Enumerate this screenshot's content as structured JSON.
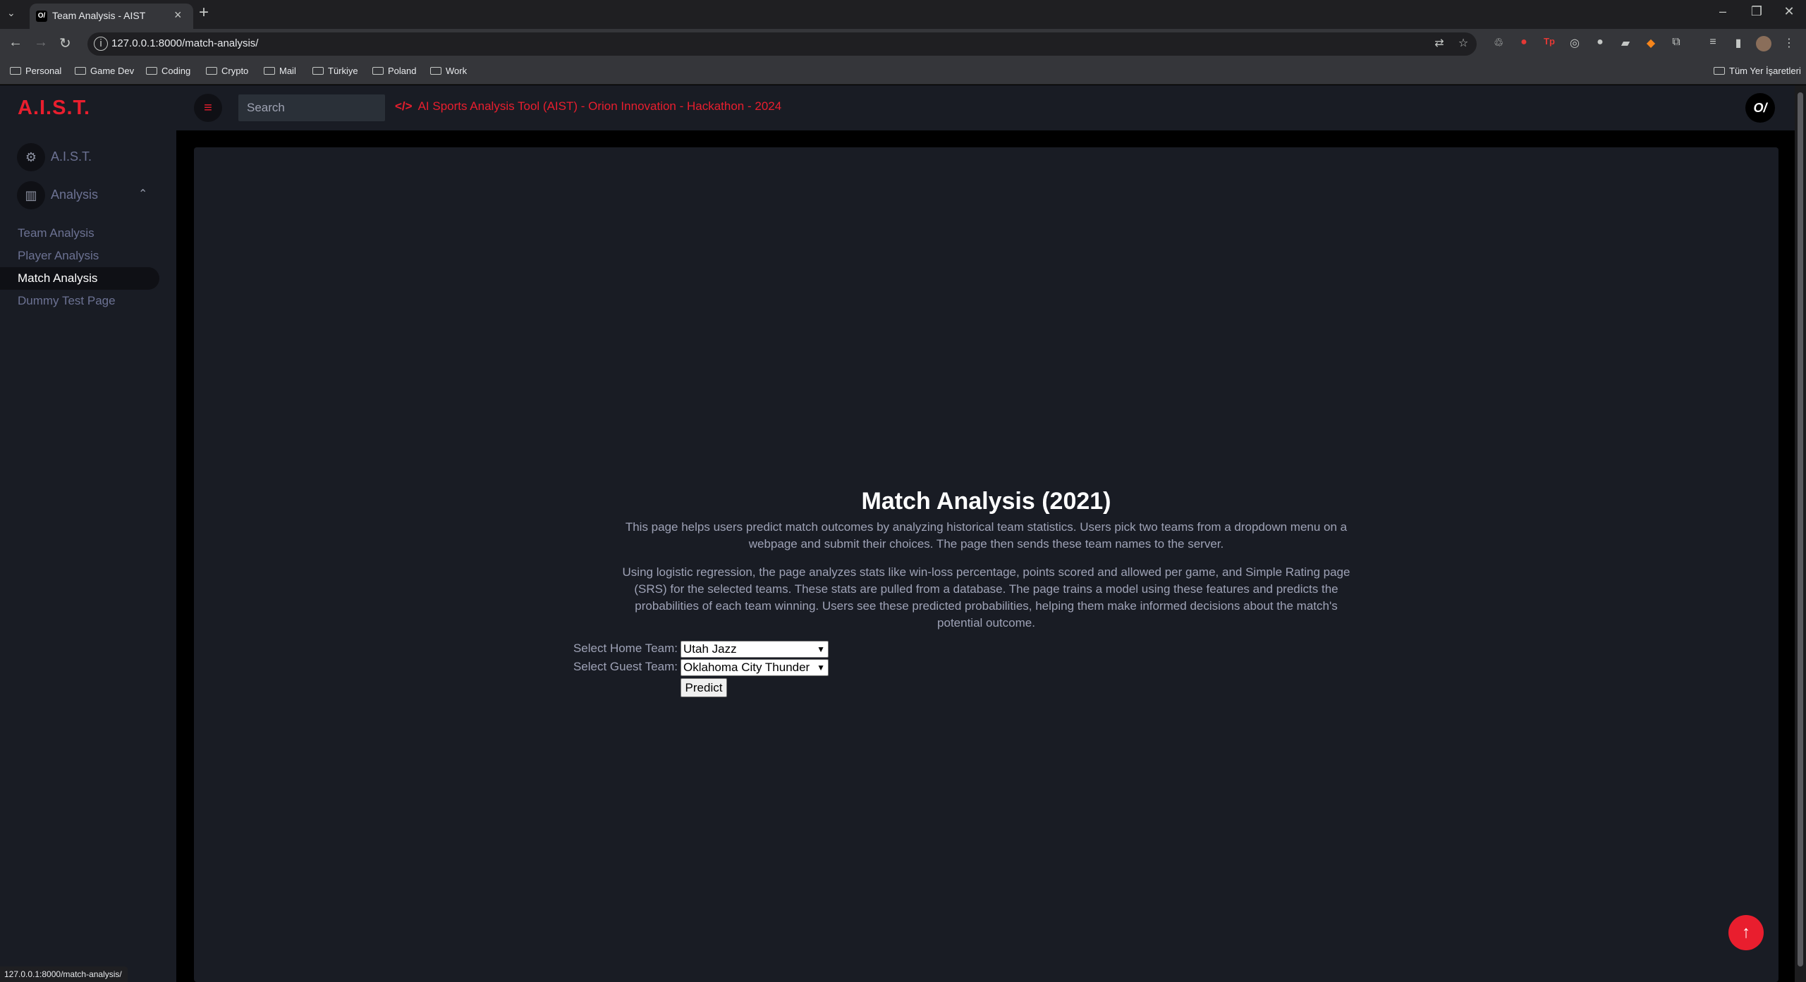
{
  "browser": {
    "tab_title": "Team Analysis - AIST",
    "tab_favicon": "O/",
    "url": "127.0.0.1:8000/match-analysis/",
    "status_url": "127.0.0.1:8000/match-analysis/",
    "bookmarks": [
      "Personal",
      "Game Dev",
      "Coding",
      "Crypto",
      "Mail",
      "Türkiye",
      "Poland",
      "Work"
    ],
    "all_bookmarks": "Tüm Yer İşaretleri"
  },
  "sidebar": {
    "brand": "A.I.S.T.",
    "main_items": [
      {
        "label": "A.I.S.T.",
        "icon": "dashboard-icon"
      },
      {
        "label": "Analysis",
        "icon": "chart-icon"
      }
    ],
    "sub_items": [
      {
        "label": "Team Analysis",
        "active": false
      },
      {
        "label": "Player Analysis",
        "active": false
      },
      {
        "label": "Match Analysis",
        "active": true
      },
      {
        "label": "Dummy Test Page",
        "active": false
      }
    ]
  },
  "topnav": {
    "search_placeholder": "Search",
    "banner": "AI Sports Analysis Tool (AIST) - Orion Innovation - Hackathon - 2024",
    "logo": "O/"
  },
  "main": {
    "title": "Match Analysis (2021)",
    "paragraph1": "This page helps users predict match outcomes by analyzing historical team statistics. Users pick two teams from a dropdown menu on a webpage and submit their choices. The page then sends these team names to the server.",
    "paragraph2": "Using logistic regression, the page analyzes stats like win-loss percentage, points scored and allowed per game, and Simple Rating page (SRS) for the selected teams. These stats are pulled from a database. The page trains a model using these features and predicts the probabilities of each team winning. Users see these predicted probabilities, helping them make informed decisions about the match's potential outcome.",
    "home_label": "Select Home Team:",
    "home_value": "Utah Jazz",
    "guest_label": "Select Guest Team:",
    "guest_value": "Oklahoma City Thunder",
    "predict_label": "Predict"
  },
  "colors": {
    "accent": "#e91e2e",
    "sidebar_bg": "#191c24",
    "page_bg": "#000000"
  }
}
